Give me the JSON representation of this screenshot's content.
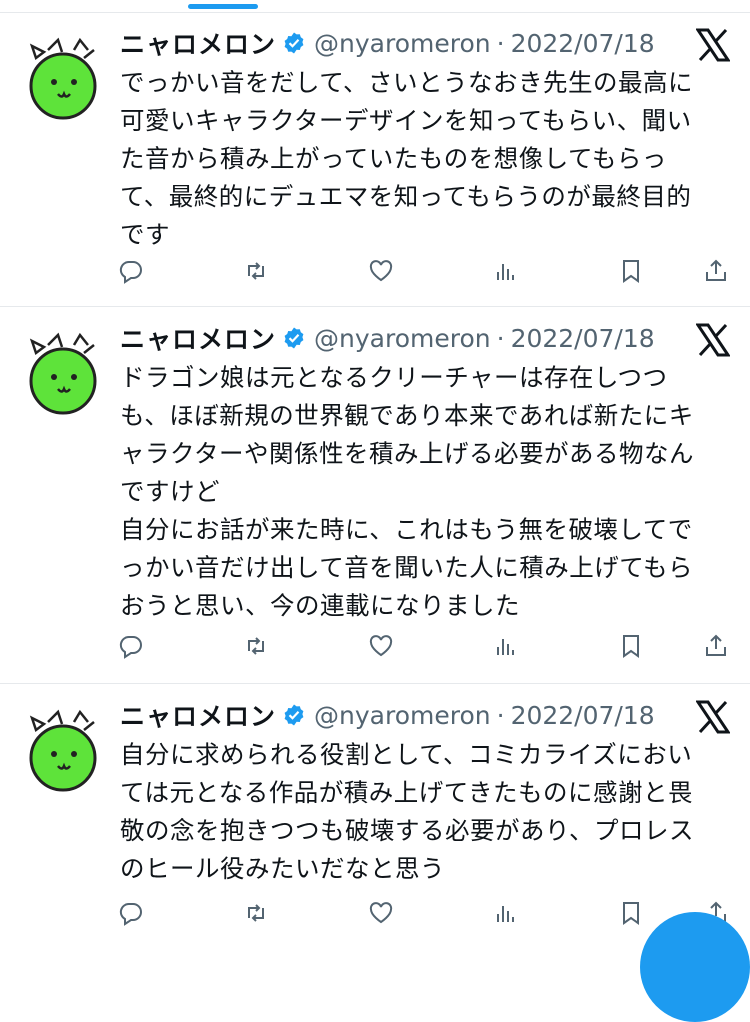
{
  "tweets": [
    {
      "name": "ニャロメロン",
      "handle": "@nyaromeron",
      "separator": "·",
      "date": "2022/07/18",
      "lines": [
        "でっかい音をだして、さいとうなおき先生の最高に",
        "可愛いキャラクターデザインを知ってもらい、聞い",
        "た音から積み上がっていたものを想像してもらっ",
        "て、最終的にデュエマを知ってもらうのが最終目的",
        "です"
      ]
    },
    {
      "name": "ニャロメロン",
      "handle": "@nyaromeron",
      "separator": "·",
      "date": "2022/07/18",
      "lines": [
        "ドラゴン娘は元となるクリーチャーは存在しつつ",
        "も、ほぼ新規の世界観であり本来であれば新たにキ",
        "ャラクターや関係性を積み上げる必要がある物なん",
        "ですけど",
        "自分にお話が来た時に、これはもう無を破壊してで",
        "っかい音だけ出して音を聞いた人に積み上げてもら",
        "おうと思い、今の連載になりました"
      ]
    },
    {
      "name": "ニャロメロン",
      "handle": "@nyaromeron",
      "separator": "·",
      "date": "2022/07/18",
      "lines": [
        "自分に求められる役割として、コミカライズにおい",
        "ては元となる作品が積み上げてきたものに感謝と畏",
        "敬の念を抱きつつも破壊する必要があり、プロレス",
        "のヒール役みたいだなと思う"
      ]
    }
  ],
  "icons": {
    "verified": "verified-badge-icon",
    "platform": "x-logo-icon",
    "actions": [
      "reply-icon",
      "retweet-icon",
      "like-icon",
      "views-icon",
      "bookmark-icon",
      "share-icon"
    ]
  },
  "colors": {
    "accent": "#1d9bf0",
    "text": "#0f1419",
    "secondary": "#536471",
    "avatar_green": "#5ee33a"
  }
}
